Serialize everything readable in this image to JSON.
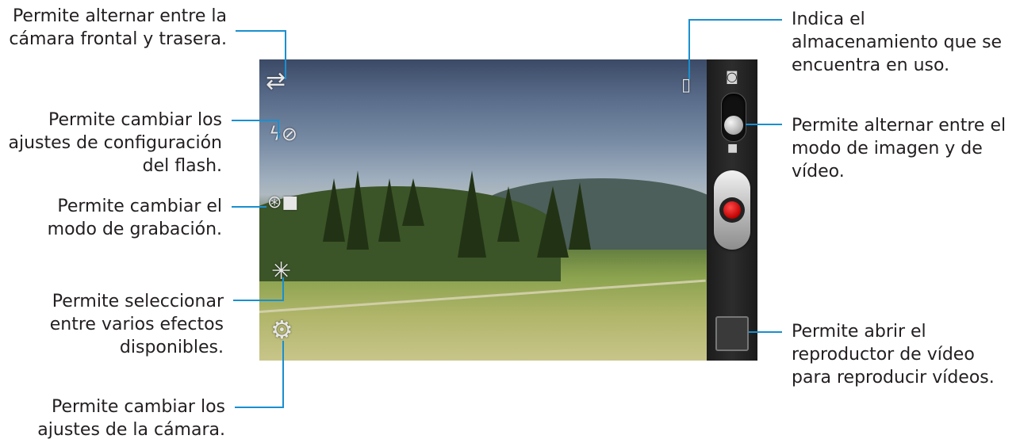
{
  "callouts": {
    "switch_camera": "Permite alternar entre la\ncámara frontal y trasera.",
    "flash": "Permite cambiar los\najustes de configuración\ndel flash.",
    "recording_mode": "Permite cambiar el\nmodo de grabación.",
    "effects": "Permite seleccionar\nentre varios efectos\ndisponibles.",
    "settings": "Permite cambiar los\najustes de la cámara.",
    "storage": "Indica el\nalmacenamiento que se\nencuentra en uso.",
    "mode_toggle": "Permite alternar entre el\nmodo de imagen y de\nvídeo.",
    "video_player": "Permite abrir el\nreproductor de vídeo\npara reproducir vídeos."
  },
  "icons": {
    "switch_camera": "⇄",
    "flash_off": "ϟ⊘",
    "recording_mode": "⊛■",
    "effects": "✳",
    "settings": "⚙",
    "storage": "▯",
    "camera": "◙",
    "video": "■"
  },
  "colors": {
    "leader_line": "#1a8fcf",
    "record_button": "#d00000"
  }
}
